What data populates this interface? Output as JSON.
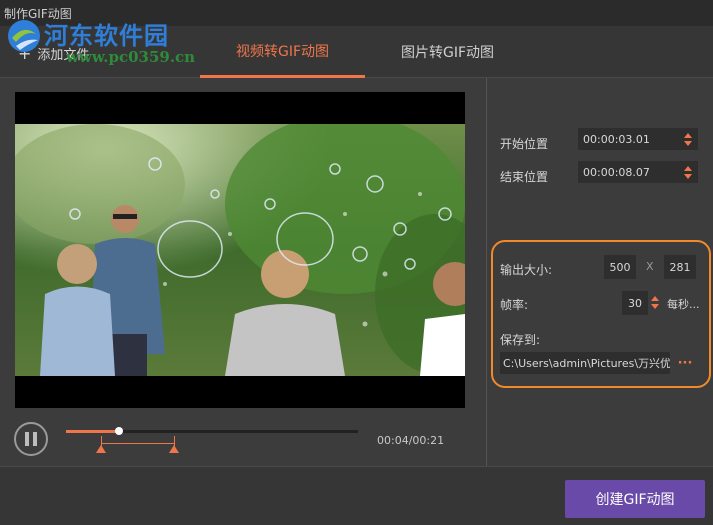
{
  "window": {
    "title": "制作GIF动图"
  },
  "watermark": {
    "brand": "河东软件园",
    "url": "www.pc0359.cn"
  },
  "toolbar": {
    "add_file_label": "添加文件"
  },
  "tabs": [
    {
      "label": "视频转GIF动图",
      "active": true
    },
    {
      "label": "图片转GIF动图",
      "active": false
    }
  ],
  "player": {
    "current_time": "00:04",
    "total_time": "00:21",
    "time_readout": "00:04/00:21",
    "progress_fraction": 0.18,
    "range_start_fraction": 0.12,
    "range_end_fraction": 0.37
  },
  "settings": {
    "start_label": "开始位置",
    "start_value": "00:00:03.01",
    "end_label": "结束位置",
    "end_value": "00:00:08.07",
    "output_size_label": "输出大小:",
    "width_value": "500",
    "size_separator": "X",
    "height_value": "281",
    "frame_rate_label": "帧率:",
    "frame_rate_value": "30",
    "frame_rate_unit": "每秒...",
    "save_to_label": "保存到:",
    "save_path": "C:\\Users\\admin\\Pictures\\万兴优",
    "more_label": "···"
  },
  "actions": {
    "create_label": "创建GIF动图"
  },
  "colors": {
    "accent": "#f0764a",
    "highlight_outline": "#f08a2a",
    "primary_button": "#6a4aa8",
    "background": "#3c3c3c"
  }
}
